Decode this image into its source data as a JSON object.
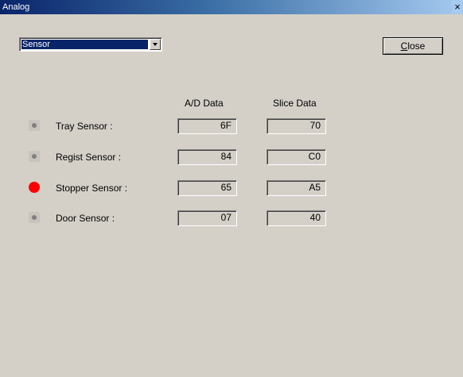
{
  "window": {
    "title": "Analog",
    "close_glyph": "×"
  },
  "selector": {
    "selected": "Sensor"
  },
  "close_button": {
    "label_mnemonic": "C",
    "label_rest": "lose"
  },
  "columns": {
    "ad": "A/D Data",
    "slice": "Slice Data"
  },
  "sensors": [
    {
      "label": "Tray Sensor :",
      "ad": "6F",
      "slice": "70",
      "active": false
    },
    {
      "label": "Regist Sensor :",
      "ad": "84",
      "slice": "C0",
      "active": false
    },
    {
      "label": "Stopper Sensor :",
      "ad": "65",
      "slice": "A5",
      "active": true
    },
    {
      "label": "Door Sensor :",
      "ad": "07",
      "slice": "40",
      "active": false
    }
  ],
  "colors": {
    "active": "#ff0000",
    "inactive": "#808080"
  }
}
